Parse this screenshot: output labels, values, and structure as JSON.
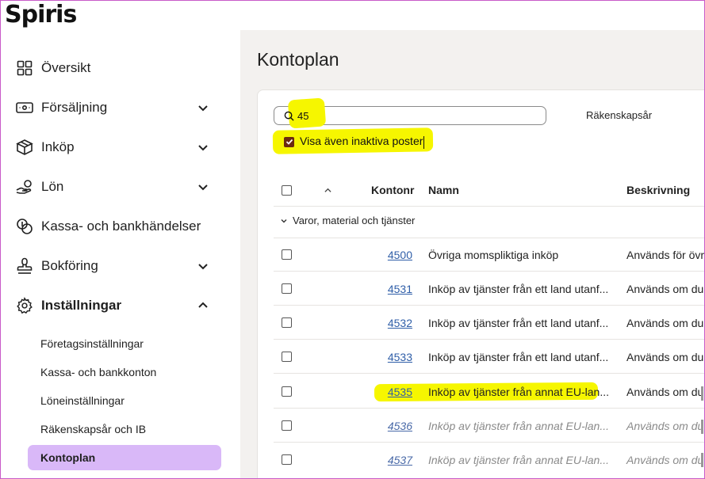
{
  "brand": {
    "logo": "Spiris"
  },
  "sidebar": {
    "items": [
      {
        "label": "Översikt",
        "icon": "grid-icon",
        "chevron": false
      },
      {
        "label": "Försäljning",
        "icon": "wallet-icon",
        "chevron": "down"
      },
      {
        "label": "Inköp",
        "icon": "box-icon",
        "chevron": "down"
      },
      {
        "label": "Lön",
        "icon": "hand-coins-icon",
        "chevron": "down"
      },
      {
        "label": "Kassa- och bankhändelser",
        "icon": "coins-icon",
        "chevron": false
      },
      {
        "label": "Bokföring",
        "icon": "stamp-icon",
        "chevron": "down"
      },
      {
        "label": "Inställningar",
        "icon": "gear-icon",
        "chevron": "up"
      }
    ],
    "subitems": [
      {
        "label": "Företagsinställningar",
        "active": false
      },
      {
        "label": "Kassa- och bankkonton",
        "active": false
      },
      {
        "label": "Löneinställningar",
        "active": false
      },
      {
        "label": "Räkenskapsår och IB",
        "active": false
      },
      {
        "label": "Kontoplan",
        "active": true
      }
    ]
  },
  "main": {
    "title": "Kontoplan",
    "search": {
      "value": "45"
    },
    "fiscal_year_label": "Räkenskapsår",
    "show_inactive": {
      "label": "Visa även inaktiva poster",
      "checked": true
    },
    "table": {
      "columns": {
        "number": "Kontonr",
        "name": "Namn",
        "description": "Beskrivning"
      },
      "group": "Varor, material och tjänster",
      "rows": [
        {
          "number": "4500",
          "name": "Övriga momspliktiga inköp",
          "description": "Används för övr",
          "inactive": false
        },
        {
          "number": "4531",
          "name": "Inköp av tjänster från ett land utanf...",
          "description": "Används om du",
          "inactive": false
        },
        {
          "number": "4532",
          "name": "Inköp av tjänster från ett land utanf...",
          "description": "Används om du",
          "inactive": false
        },
        {
          "number": "4533",
          "name": "Inköp av tjänster från ett land utanf...",
          "description": "Används om du",
          "inactive": false
        },
        {
          "number": "4535",
          "name": "Inköp av tjänster från annat EU-lan...",
          "description": "Används om du",
          "inactive": false
        },
        {
          "number": "4536",
          "name": "Inköp av tjänster från annat EU-lan...",
          "description": "Används om du",
          "inactive": true
        },
        {
          "number": "4537",
          "name": "Inköp av tjänster från annat EU-lan...",
          "description": "Används om du",
          "inactive": true
        }
      ]
    }
  },
  "colors": {
    "active_nav_bg": "#d9b8f8",
    "highlight": "#f6f600",
    "link": "#2f5ea8",
    "checkbox_checked": "#6b2b10"
  }
}
